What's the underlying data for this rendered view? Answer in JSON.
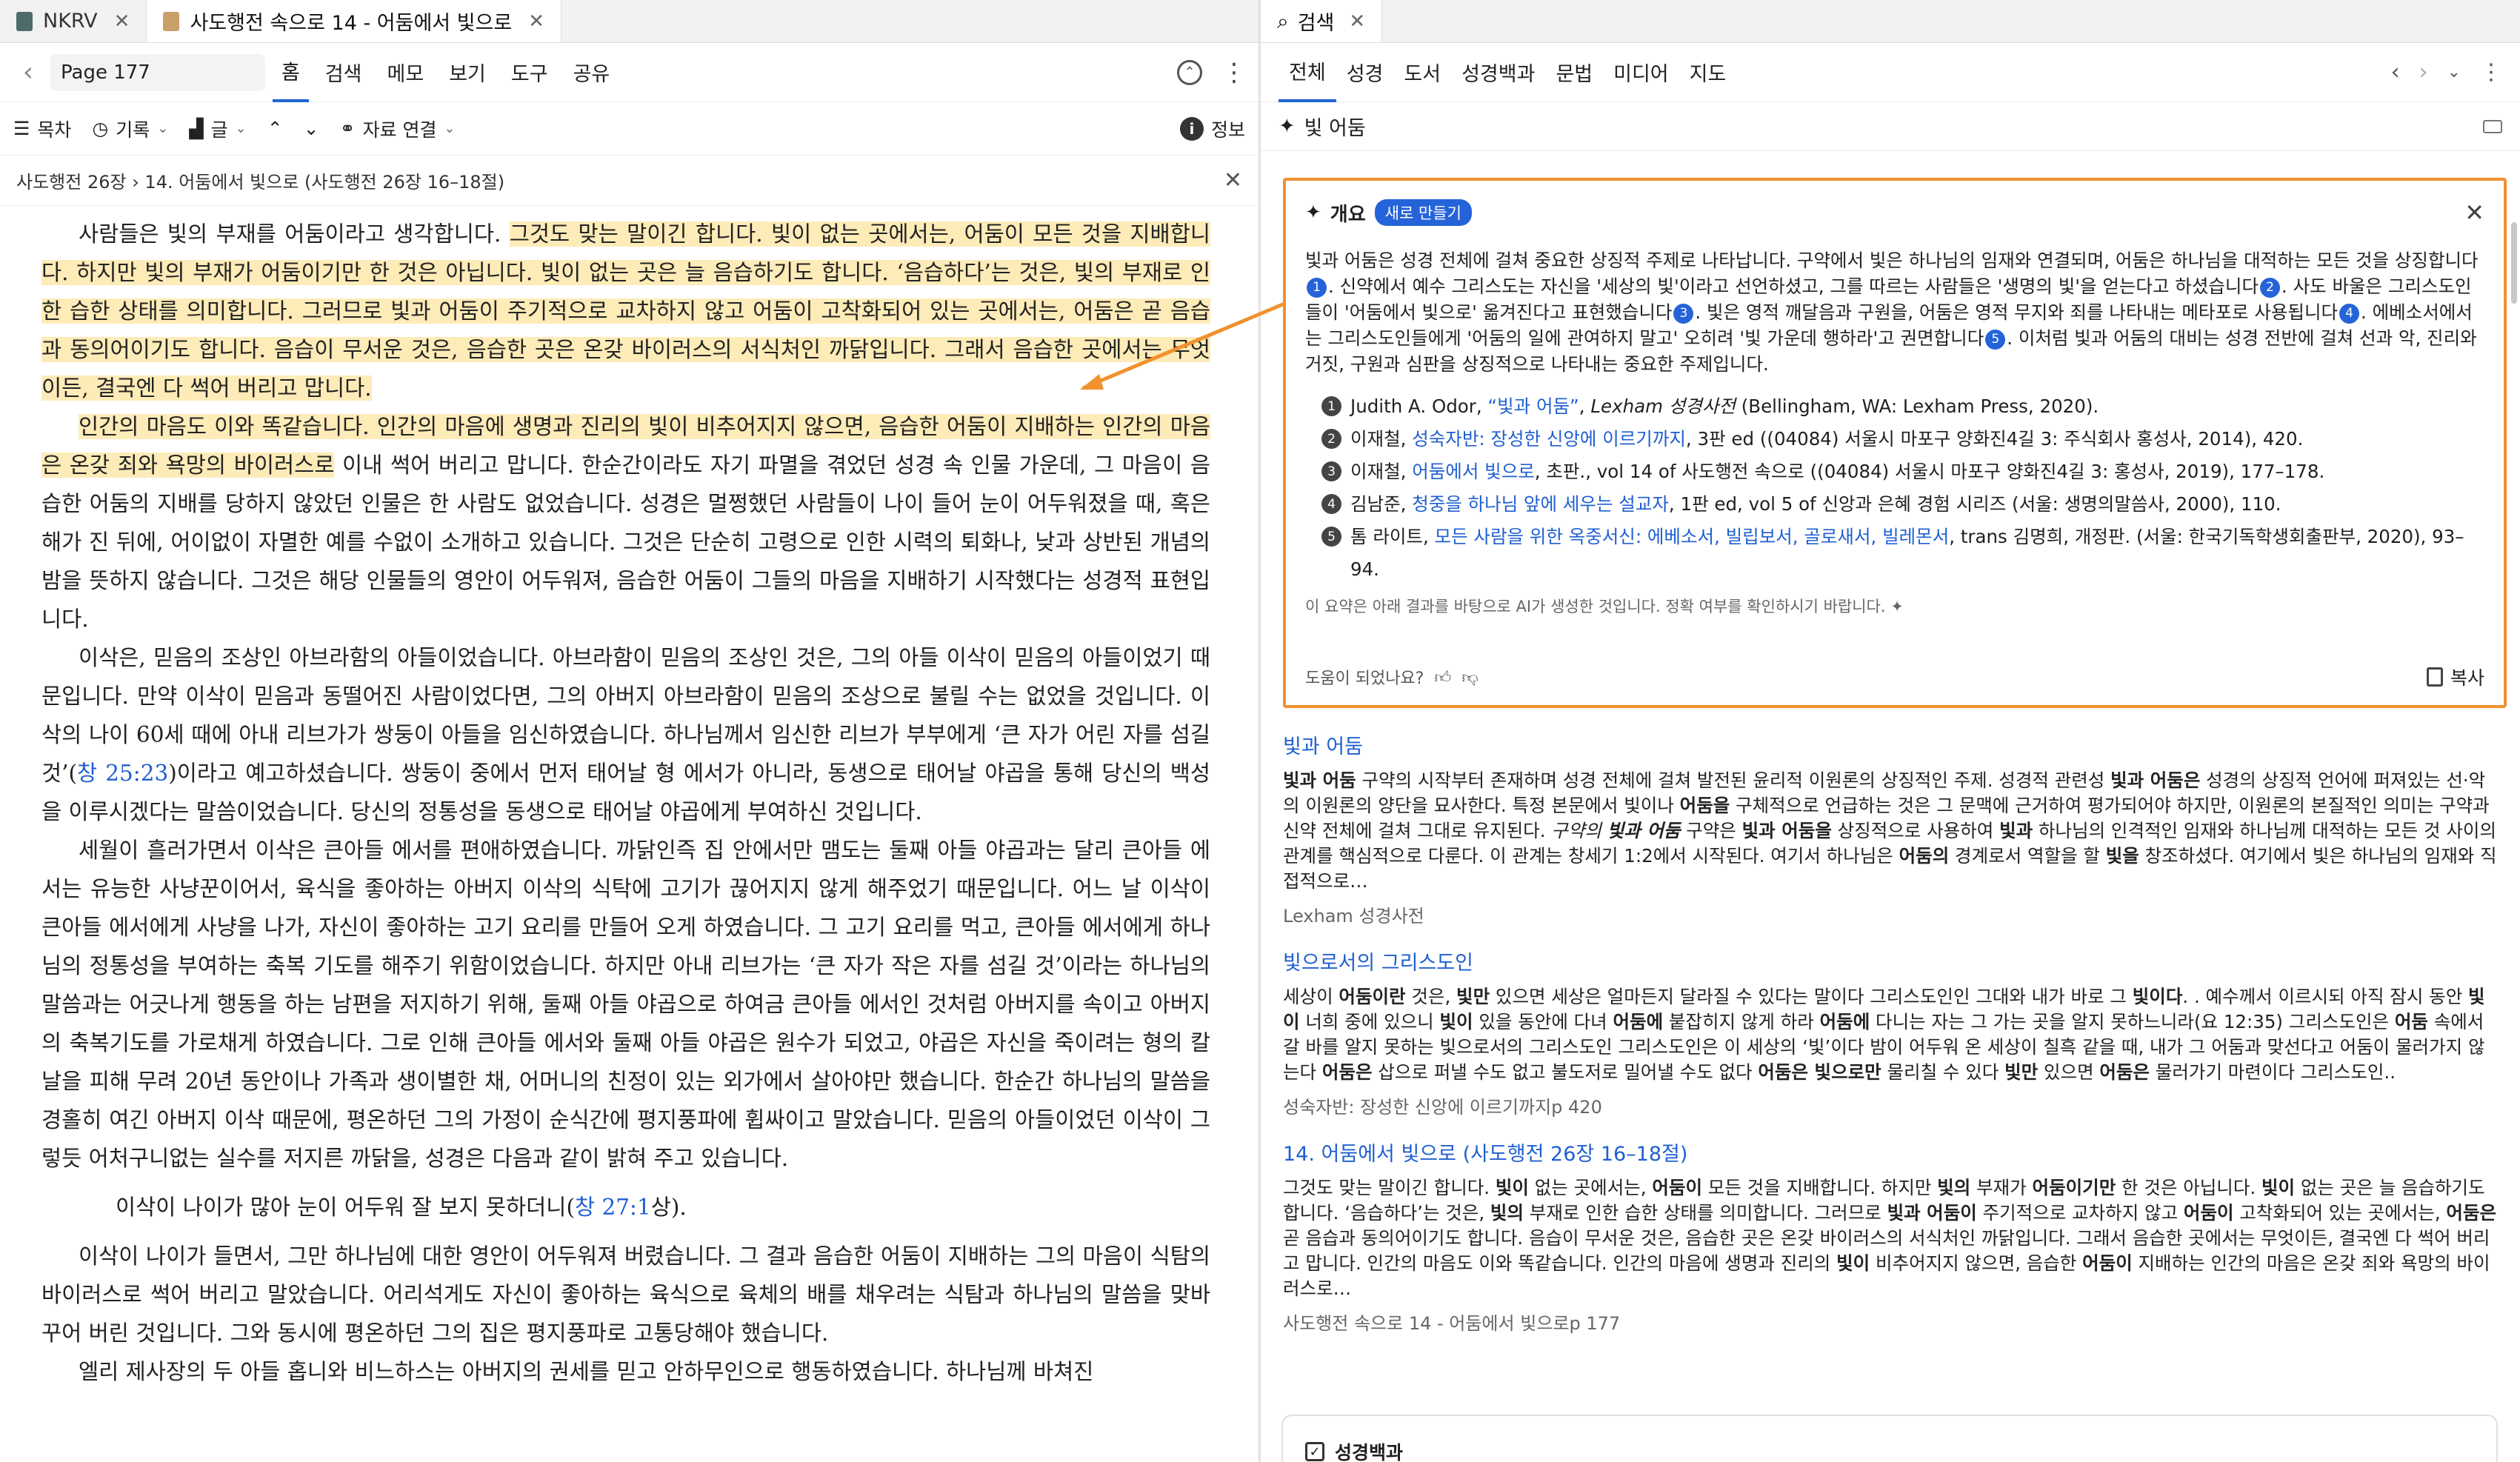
{
  "left_tabs": [
    {
      "label": "NKRV"
    },
    {
      "label": "사도행전 속으로 14 - 어둠에서 빛으로"
    }
  ],
  "toolbar": {
    "page": "Page 177",
    "items": [
      "홈",
      "검색",
      "메모",
      "보기",
      "도구",
      "공유"
    ]
  },
  "toolbar2": {
    "toc": "목차",
    "history": "기록",
    "text": "글",
    "link": "자료 연결",
    "info": "정보"
  },
  "breadcrumb": "사도행전 26장 › 14. 어둠에서 빛으로 (사도행전 26장 16–18절)",
  "reader": {
    "p1_hl_a": "사람들은 빛의 부재를 어둠이라고 생각합니다. ",
    "p1_hl_b": "그것도 맞는 말이긴 합니다. 빛이 없는 곳에서는, 어둠이 모든 것을 지배합니다. 하지만 빛의 부재가 어둠이기만 한 것은 아닙니다. 빛이 없는 곳은 늘 음습하기도 합니다. ‘음습하다’는 것은, 빛의 부재로 인한 습한 상태를 의미합니다. 그러므로 빛과 어둠이 주기적으로 교차하지 않고 어둠이 고착화되어 있는 곳에서는, 어둠은 곧 음습과 동의어이기도 합니다. 음습이 무서운 것은, 음습한 곳은 온갖 바이러스의 서식처인 까닭입니다. 그래서 음습한 곳에서는 무엇이든, 결국엔 다 썩어 버리고 맙니다.",
    "p2_hl": "인간의 마음도 이와 똑같습니다. 인간의 마음에 생명과 진리의 빛이 비추어지지 않으면, 음습한 어둠이 지배하는 인간의 마음은 온갖 죄와 욕망의 바이러스로",
    "p2_rest": " 이내 썩어 버리고 맙니다. 한순간이라도 자기 파멸을 겪었던 성경 속 인물 가운데, 그 마음이 음습한 어둠의 지배를 당하지 않았던 인물은 한 사람도 없었습니다. 성경은 멀쩡했던 사람들이 나이 들어 눈이 어두워졌을 때, 혹은 해가 진 뒤에, 어이없이 자멸한 예를 수없이 소개하고 있습니다. 그것은 단순히 고령으로 인한 시력의 퇴화나, 낮과 상반된 개념의 밤을 뜻하지 않습니다. 그것은 해당 인물들의 영안이 어두워져, 음습한 어둠이 그들의 마음을 지배하기 시작했다는 성경적 표현입니다.",
    "p3_a": "이삭은, 믿음의 조상인 아브라함의 아들이었습니다. 아브라함이 믿음의 조상인 것은, 그의 아들 이삭이 믿음의 아들이었기 때문입니다. 만약 이삭이 믿음과 동떨어진 사람이었다면, 그의 아버지 아브라함이 믿음의 조상으로 불릴 수는 없었을 것입니다. 이삭의 나이 60세 때에 아내 리브가가 쌍둥이 아들을 임신하였습니다. 하나님께서 임신한 리브가 부부에게 ‘큰 자가 어린 자를 섬길 것’(",
    "p3_ref": "창 25:23",
    "p3_b": ")이라고 예고하셨습니다. 쌍둥이 중에서 먼저 태어날 형 에서가 아니라, 동생으로 태어날 야곱을 통해 당신의 백성을 이루시겠다는 말씀이었습니다. 당신의 정통성을 동생으로 태어날 야곱에게 부여하신 것입니다.",
    "p4": "세월이 흘러가면서 이삭은 큰아들 에서를 편애하였습니다. 까닭인즉 집 안에서만 맴도는 둘째 아들 야곱과는 달리 큰아들 에서는 유능한 사냥꾼이어서, 육식을 좋아하는 아버지 이삭의 식탁에 고기가 끊어지지 않게 해주었기 때문입니다. 어느 날 이삭이 큰아들 에서에게 사냥을 나가, 자신이 좋아하는 고기 요리를 만들어 오게 하였습니다. 그 고기 요리를 먹고, 큰아들 에서에게 하나님의 정통성을 부여하는 축복 기도를 해주기 위함이었습니다. 하지만 아내 리브가는 ‘큰 자가 작은 자를 섬길 것’이라는 하나님의 말씀과는 어긋나게 행동을 하는 남편을 저지하기 위해, 둘째 아들 야곱으로 하여금 큰아들 에서인 것처럼 아버지를 속이고 아버지의 축복기도를 가로채게 하였습니다. 그로 인해 큰아들 에서와 둘째 아들 야곱은 원수가 되었고, 야곱은 자신을 죽이려는 형의 칼날을 피해 무려 20년 동안이나 가족과 생이별한 채, 어머니의 친정이 있는 외가에서 살아야만 했습니다. 한순간 하나님의 말씀을 경홀히 여긴 아버지 이삭 때문에, 평온하던 그의 가정이 순식간에 평지풍파에 휩싸이고 말았습니다. 믿음의 아들이었던 이삭이 그렇듯 어처구니없는 실수를 저지른 까닭을, 성경은 다음과 같이 밝혀 주고 있습니다.",
    "quote_a": "이삭이 나이가 많아 눈이 어두워 잘 보지 못하더니(",
    "quote_ref": "창 27:1",
    "quote_b": "상).",
    "p5": "이삭이 나이가 들면서, 그만 하나님에 대한 영안이 어두워져 버렸습니다. 그 결과 음습한 어둠이 지배하는 그의 마음이 식탐의 바이러스로 썩어 버리고 말았습니다. 어리석게도 자신이 좋아하는 육식으로 육체의 배를 채우려는 식탐과 하나님의 말씀을 맞바꾸어 버린 것입니다. 그와 동시에 평온하던 그의 집은 평지풍파로 고통당해야 했습니다.",
    "p6": "엘리 제사장의 두 아들 홉니와 비느하스는 아버지의 권세를 믿고 안하무인으로 행동하였습니다. 하나님께 바쳐진"
  },
  "right_tab": {
    "label": "검색"
  },
  "rtabs": [
    "전체",
    "성경",
    "도서",
    "성경백과",
    "문법",
    "미디어",
    "지도"
  ],
  "query": "빛 어둠",
  "summary": {
    "title": "개요",
    "new_badge": "새로 만들기",
    "body": [
      {
        "t": "빛과 어둠은 성경 전체에 걸쳐 중요한 상징적 주제로 나타납니다. 구약에서 빛은 하나님의 임재와 연결되며, 어둠은 하나님을 대적하는 모든 것을 상징합니다"
      },
      {
        "r": "1"
      },
      {
        "t": ". 신약에서 예수 그리스도는 자신을 '세상의 빛'이라고 선언하셨고, 그를 따르는 사람들은 '생명의 빛'을 얻는다고 하셨습니다"
      },
      {
        "r": "2"
      },
      {
        "t": ". 사도 바울은 그리스도인들이 '어둠에서 빛으로' 옮겨진다고 표현했습니다"
      },
      {
        "r": "3"
      },
      {
        "t": ". 빛은 영적 깨달음과 구원을, 어둠은 영적 무지와 죄를 나타내는 메타포로 사용됩니다"
      },
      {
        "r": "4"
      },
      {
        "t": ". 에베소서에서는 그리스도인들에게 '어둠의 일에 관여하지 말고' 오히려 '빛 가운데 행하라'고 권면합니다"
      },
      {
        "r": "5"
      },
      {
        "t": ". 이처럼 빛과 어둠의 대비는 성경 전반에 걸쳐 선과 악, 진리와 거짓, 구원과 심판을 상징적으로 나타내는 중요한 주제입니다."
      }
    ],
    "refs": [
      {
        "n": "1",
        "pre": "Judith A. Odor, ",
        "link": "“빛과 어둠”",
        "mid": ", ",
        "it": "Lexham 성경사전",
        "post": " (Bellingham, WA: Lexham Press, 2020)."
      },
      {
        "n": "2",
        "pre": "이재철, ",
        "link": "성숙자반: 장성한 신앙에 이르기까지",
        "mid": "",
        "it": "",
        "post": ", 3판 ed ((04084) 서울시 마포구 양화진4길 3: 주식회사 홍성사, 2014), 420."
      },
      {
        "n": "3",
        "pre": "이재철, ",
        "link": "어둠에서 빛으로",
        "mid": "",
        "it": "",
        "post": ", 초판., vol 14 of 사도행전 속으로 ((04084) 서울시 마포구 양화진4길 3: 홍성사, 2019), 177–178."
      },
      {
        "n": "4",
        "pre": "김남준, ",
        "link": "청중을 하나님 앞에 세우는 설교자",
        "mid": "",
        "it": "",
        "post": ", 1판 ed, vol 5 of 신앙과 은혜 경험 시리즈 (서울: 생명의말씀사, 2000), 110."
      },
      {
        "n": "5",
        "pre": "톰 라이트, ",
        "link": "모든 사람을 위한 옥중서신: 에베소서, 빌립보서, 골로새서, 빌레몬서",
        "mid": "",
        "it": "",
        "post": ", trans 김명희, 개정판. (서울: 한국기독학생회출판부, 2020), 93–94."
      }
    ],
    "ai_note": "이 요약은 아래 결과를 바탕으로 AI가 생성한 것입니다. 정확 여부를 확인하시기 바랍니다.",
    "helpful": "도움이 되었나요?",
    "copy": "복사"
  },
  "results": [
    {
      "title": "빛과 어둠",
      "snippet": "<b>빛과 어둠</b> 구약의 시작부터 존재하며 성경 전체에 걸쳐 발전된 윤리적 이원론의 상징적인 주제. 성경적 관련성 <b>빛과 어둠은</b> 성경의 상징적 언어에 퍼져있는 선·악의 이원론의 양단을 묘사한다. 특정 본문에서 빛이나 <b>어둠을</b> 구체적으로 언급하는 것은 그 문맥에 근거하여 평가되어야 하지만, 이원론의 본질적인 의미는 구약과 신약 전체에 걸쳐 그대로 유지된다. <i>구약의 <b>빛과 어둠</b></i> 구약은 <b>빛과 어둠을</b> 상징적으로 사용하여 <b>빛과</b> 하나님의 인격적인 임재와 하나님께 대적하는 모든 것 사이의 관계를 핵심적으로 다룬다. 이 관계는 창세기 1:2에서 시작된다. 여기서 하나님은 <b>어둠의</b> 경계로서 역할을 할 <b>빛을</b> 창조하셨다. 여기에서 빛은 하나님의 임재와 직접적으로…",
      "source": "Lexham 성경사전"
    },
    {
      "title": "빛으로서의 그리스도인",
      "snippet": "세상이 <b>어둠이란</b> 것은, <b>빛만</b> 있으면 세상은 얼마든지 달라질 수 있다는 말이다 그리스도인인 그대와 내가 바로 그 <b>빛이다</b>. . 예수께서 이르시되 아직 잠시 동안 <b>빛이</b> 너희 중에 있으니 <b>빛이</b> 있을 동안에 다녀 <b>어둠에</b> 붙잡히지 않게 하라 <b>어둠에</b> 다니는 자는 그 가는 곳을 알지 못하느니라(요 12:35) 그리스도인은 <b>어둠</b> 속에서 갈 바를 알지 못하는 빛으로서의 그리스도인 그리스도인은 이 세상의 ‘빛’이다 밤이 어두워 온 세상이 칠흑 같을 때, 내가 그 어둠과 맞선다고 어둠이 물러가지 않는다 <b>어둠은</b> 삽으로 퍼낼 수도 없고 불도저로 밀어낼 수도 없다 <b>어둠은 빛으로만</b> 물리칠 수 있다 <b>빛만</b> 있으면 <b>어둠은</b> 물러가기 마련이다 그리스도인..",
      "source": "성숙자반: 장성한 신앙에 이르기까지p 420"
    },
    {
      "title": "14. 어둠에서 빛으로 (사도행전 26장 16–18절)",
      "snippet": "그것도 맞는 말이긴 합니다. <b>빛이</b> 없는 곳에서는, <b>어둠이</b> 모든 것을 지배합니다. 하지만 <b>빛의</b> 부재가 <b>어둠이기만</b> 한 것은 아닙니다. <b>빛이</b> 없는 곳은 늘 음습하기도 합니다. ‘음습하다’는 것은, <b>빛의</b> 부재로 인한 습한 상태를 의미합니다. 그러므로 <b>빛과 어둠이</b> 주기적으로 교차하지 않고 <b>어둠이</b> 고착화되어 있는 곳에서는, <b>어둠은</b> 곧 음습과 동의어이기도 합니다. 음습이 무서운 것은, 음습한 곳은 온갖 바이러스의 서식처인 까닭입니다. 그래서 음습한 곳에서는 무엇이든, 결국엔 다 썩어 버리고 맙니다. 인간의 마음도 이와 똑같습니다. 인간의 마음에 생명과 진리의 <b>빛이</b> 비추어지지 않으면, 음습한 <b>어둠이</b> 지배하는 인간의 마음은 온갖 죄와 욕망의 바이러스로…",
      "source": "사도행전 속으로 14 - 어둠에서 빛으로p 177"
    }
  ],
  "category_box": {
    "label": "성경백과"
  },
  "colors": {
    "accent": "#1f64d6",
    "highlight": "#fdebb8",
    "callout": "#f0922e",
    "link": "#1f5fd1"
  }
}
